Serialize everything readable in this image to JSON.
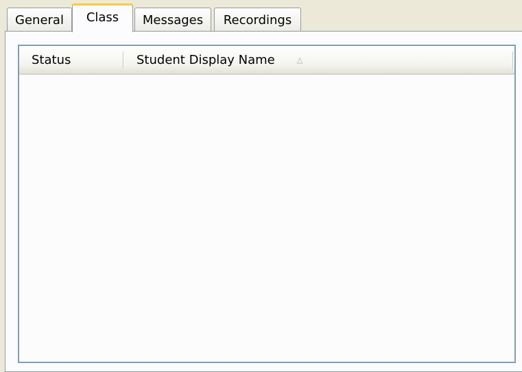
{
  "tabs": [
    {
      "label": "General"
    },
    {
      "label": "Class"
    },
    {
      "label": "Messages"
    },
    {
      "label": "Recordings"
    }
  ],
  "active_tab": "Class",
  "list": {
    "columns": [
      {
        "label": "Status"
      },
      {
        "label": "Student Display Name",
        "sort": "ascending",
        "sort_icon": "sort-ascending-icon"
      }
    ],
    "rows": []
  },
  "colors": {
    "background": "#ece9d8",
    "panel": "#fcfcfe",
    "active_tab_highlight": "#ffc83c",
    "list_border": "#7f9db9"
  }
}
